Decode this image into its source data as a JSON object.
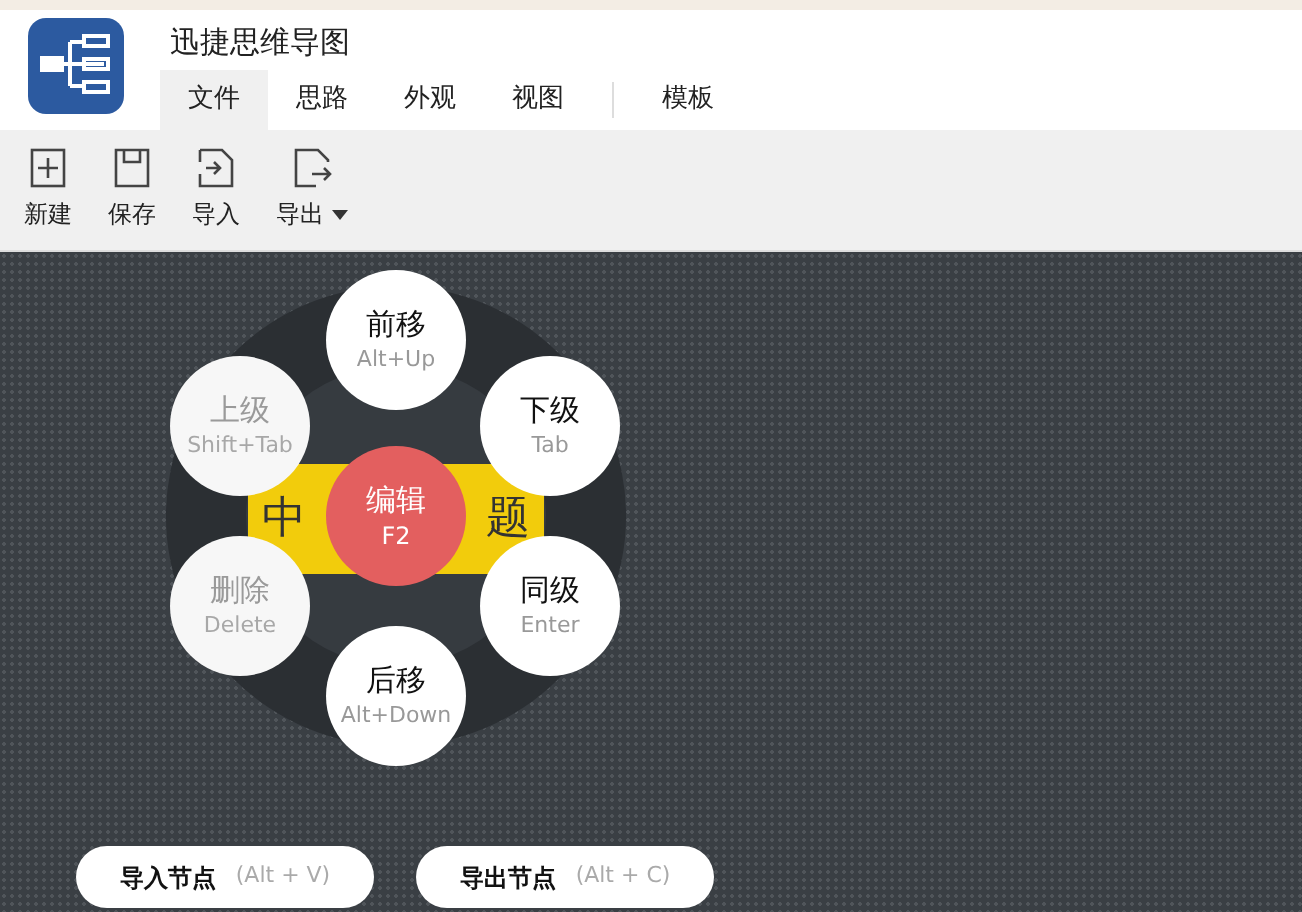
{
  "app": {
    "title": "迅捷思维导图"
  },
  "tabs": [
    {
      "label": "文件",
      "selected": true
    },
    {
      "label": "思路",
      "selected": false
    },
    {
      "label": "外观",
      "selected": false
    },
    {
      "label": "视图",
      "selected": false
    },
    {
      "label": "模板",
      "selected": false
    }
  ],
  "toolbar": [
    {
      "label": "新建",
      "kind": "new"
    },
    {
      "label": "保存",
      "kind": "save"
    },
    {
      "label": "导入",
      "kind": "import"
    },
    {
      "label": "导出",
      "kind": "export",
      "dropdown": true
    }
  ],
  "center_topic": {
    "left_part": "中",
    "right_part": "题"
  },
  "radial_menu": {
    "center": {
      "label": "编辑",
      "shortcut": "F2"
    },
    "items": [
      {
        "label": "前移",
        "shortcut": "Alt+Up",
        "disabled": false
      },
      {
        "label": "上级",
        "shortcut": "Shift+Tab",
        "disabled": true
      },
      {
        "label": "下级",
        "shortcut": "Tab",
        "disabled": false
      },
      {
        "label": "删除",
        "shortcut": "Delete",
        "disabled": true
      },
      {
        "label": "同级",
        "shortcut": "Enter",
        "disabled": false
      },
      {
        "label": "后移",
        "shortcut": "Alt+Down",
        "disabled": false
      }
    ]
  },
  "bottom_buttons": [
    {
      "label": "导入节点",
      "shortcut": "(Alt + V)"
    },
    {
      "label": "导出节点",
      "shortcut": "(Alt + C)"
    }
  ]
}
